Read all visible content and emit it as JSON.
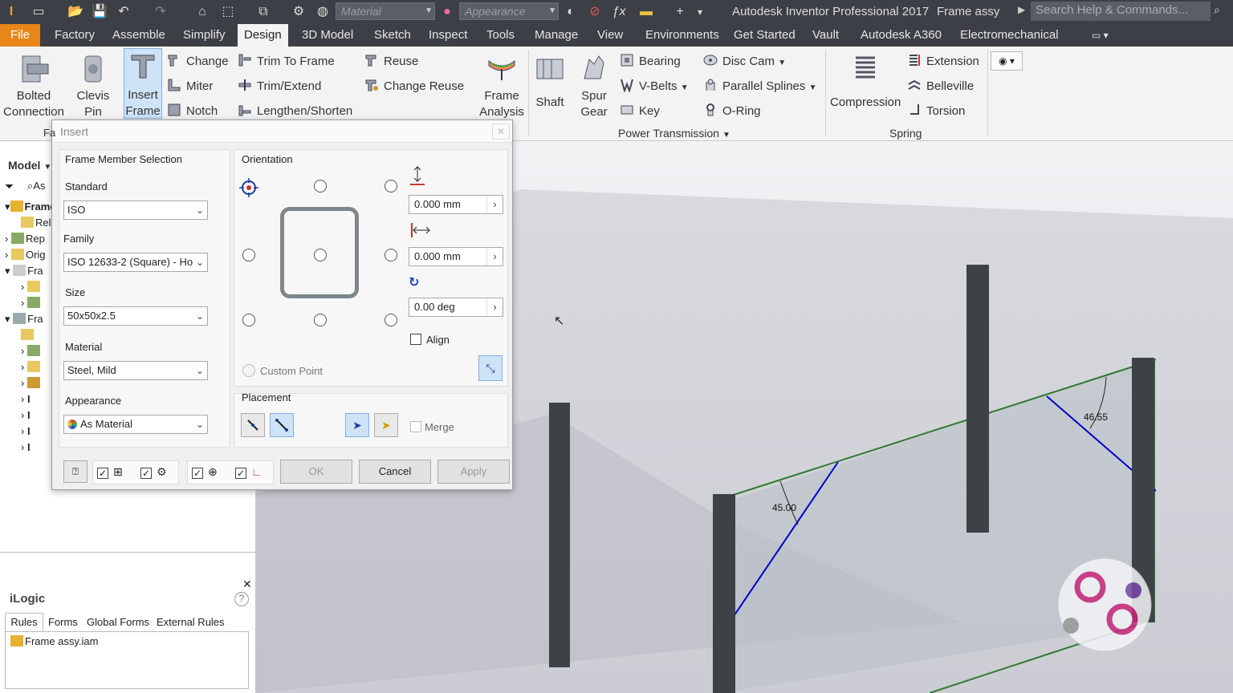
{
  "titlebar": {
    "material_placeholder": "Material",
    "appearance_placeholder": "Appearance",
    "app_title": "Autodesk Inventor Professional 2017",
    "doc_title": "Frame assy",
    "search_placeholder": "Search Help & Commands..."
  },
  "menubar": {
    "file": "File",
    "tabs": [
      "Factory",
      "Assemble",
      "Simplify",
      "Design",
      "3D Model",
      "Sketch",
      "Inspect",
      "Tools",
      "Manage",
      "View",
      "Environments",
      "Get Started",
      "Vault",
      "Autodesk A360",
      "Electromechanical"
    ],
    "active": "Design"
  },
  "ribbon": {
    "bolted": "Bolted\nConnection",
    "clevis": "Clevis\nPin",
    "insert_frame": "Insert\nFrame",
    "change": "Change",
    "miter": "Miter",
    "notch": "Notch",
    "trim_to_frame": "Trim To Frame",
    "trim_extend": "Trim/Extend",
    "lengthen": "Lengthen/Shorten",
    "reuse": "Reuse",
    "change_reuse": "Change Reuse",
    "frame_analysis": "Frame\nAnalysis",
    "shaft": "Shaft",
    "spur_gear": "Spur\nGear",
    "bearing": "Bearing",
    "vbelts": "V-Belts",
    "key": "Key",
    "disc_cam": "Disc Cam",
    "parallel_splines": "Parallel Splines",
    "oring": "O-Ring",
    "power_transmission": "Power Transmission",
    "compression": "Compression",
    "extension": "Extension",
    "belleville": "Belleville",
    "torsion": "Torsion",
    "spring": "Spring",
    "fa_fragment": "Fa"
  },
  "browser": {
    "model_label": "Model",
    "search_fragment": "As",
    "rows": [
      "Frame",
      "Rela",
      "Rep",
      "Orig",
      "Fra",
      "",
      "",
      "Fra",
      "",
      "",
      "",
      "",
      "",
      "",
      ""
    ]
  },
  "dialog": {
    "title": "Insert",
    "frame_member_selection": "Frame Member Selection",
    "standard_label": "Standard",
    "standard_value": "ISO",
    "family_label": "Family",
    "family_value": "ISO 12633-2 (Square) - Ho",
    "size_label": "Size",
    "size_value": "50x50x2.5",
    "material_label": "Material",
    "material_value": "Steel, Mild",
    "appearance_label": "Appearance",
    "appearance_value": "As Material",
    "orientation": "Orientation",
    "offset1": "0.000 mm",
    "offset2": "0.000 mm",
    "angle": "0.00 deg",
    "align": "Align",
    "custom_point": "Custom Point",
    "placement": "Placement",
    "merge": "Merge",
    "ok": "OK",
    "cancel": "Cancel",
    "apply": "Apply"
  },
  "ilogic": {
    "title": "iLogic",
    "tabs": [
      "Rules",
      "Forms",
      "Global Forms",
      "External Rules"
    ],
    "item": "Frame assy.iam"
  },
  "viewport": {
    "angle1": "45.00",
    "angle2": "46.55"
  },
  "colors": {
    "titlebar": "#3c3f46",
    "accent_file": "#e8861a",
    "frame_rail": "#2f7a2f",
    "miter_line": "#0000cc",
    "pillar": "#3d4246"
  }
}
